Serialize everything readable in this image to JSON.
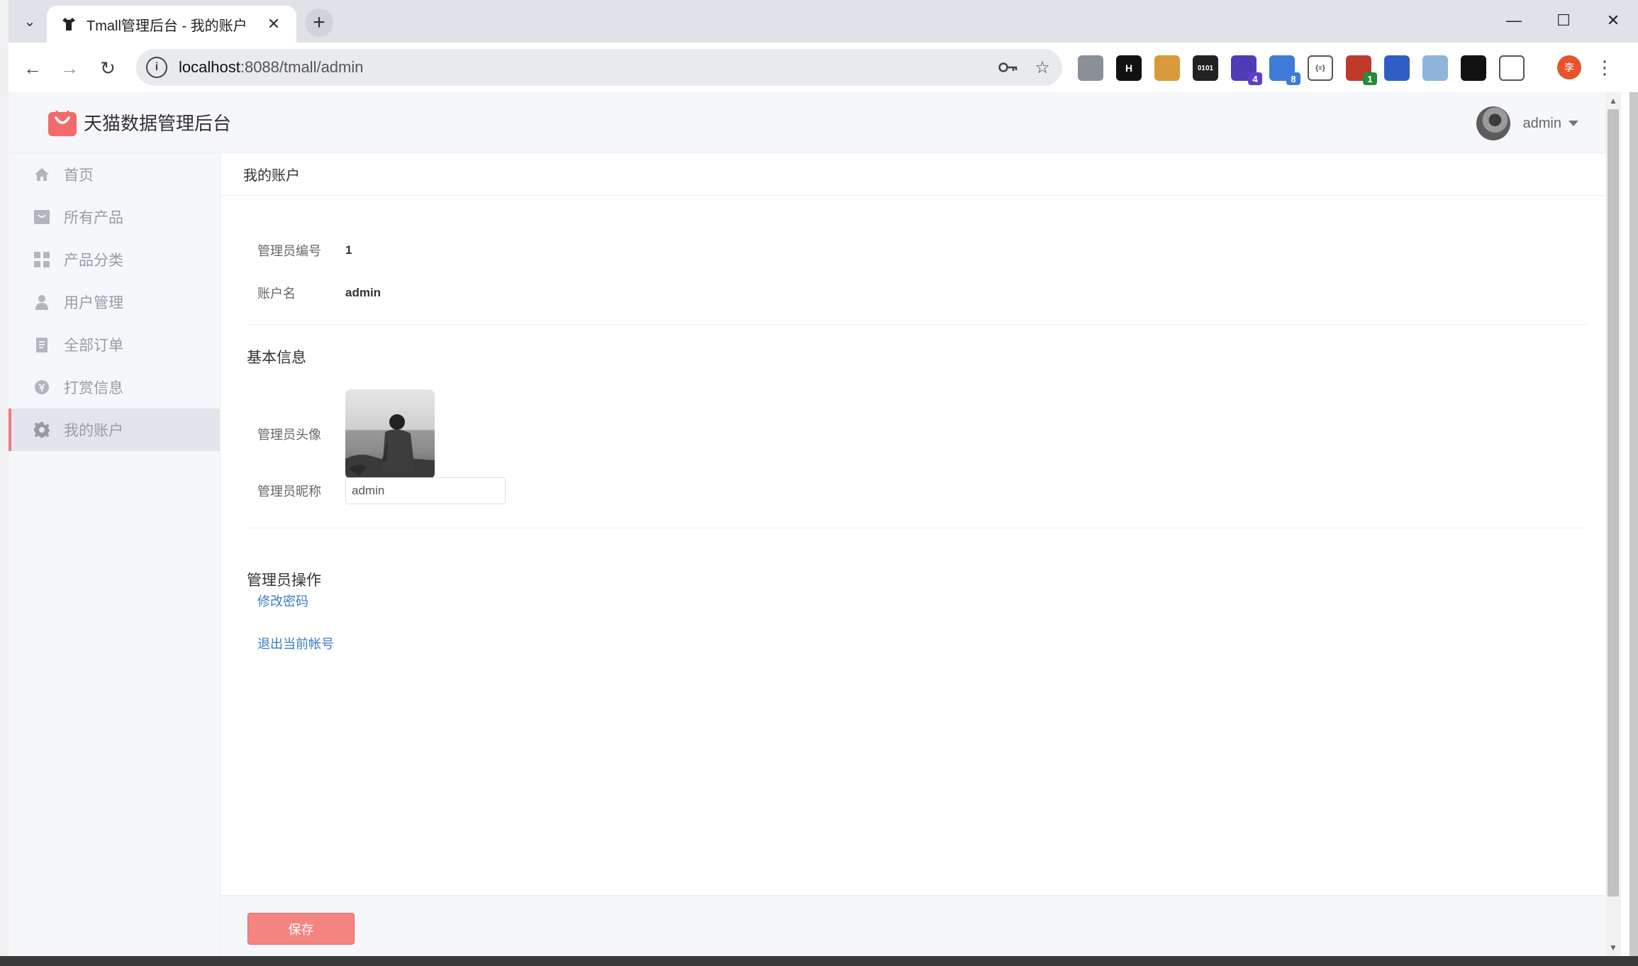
{
  "browser": {
    "tab_title": "Tmall管理后台 - 我的账户",
    "tab_close": "✕",
    "new_tab": "+",
    "url_host": "localhost",
    "url_rest": ":8088/tmall/admin",
    "profile_initial": "李",
    "extensions": [
      {
        "name": "globe-extension-icon",
        "label": "",
        "color": "#8a8f98"
      },
      {
        "name": "h-extension-icon",
        "label": "H",
        "color": "#111111"
      },
      {
        "name": "cookie-extension-icon",
        "label": "",
        "color": "#d89a3a"
      },
      {
        "name": "binary-extension-icon",
        "label": "0101",
        "color": "#222222"
      },
      {
        "name": "shapes-extension-icon",
        "label": "",
        "color": "#4f3bb5",
        "badge": "4",
        "badge_color": "#5b3fc8"
      },
      {
        "name": "screenshot-extension-icon",
        "label": "",
        "color": "#3d7bd9",
        "badge": "8",
        "badge_color": "#3d7bd9"
      },
      {
        "name": "json-extension-icon",
        "label": "{≡}",
        "color": "#ffffff"
      },
      {
        "name": "counter-extension-icon",
        "label": "",
        "color": "#c0392b",
        "badge": "1",
        "badge_color": "#1f8f3a"
      },
      {
        "name": "bookmark-extension-icon",
        "label": "",
        "color": "#2f5fc4"
      },
      {
        "name": "person-extension-icon",
        "label": "",
        "color": "#8fb5dd"
      },
      {
        "name": "glasses-extension-icon",
        "label": "",
        "color": "#111111"
      },
      {
        "name": "puzzle-extension-icon",
        "label": "",
        "color": "#ffffff"
      }
    ]
  },
  "app": {
    "brand_title": "天猫数据管理后台",
    "user_name": "admin",
    "colors": {
      "accent": "#f07a7a",
      "link": "#3a7cc6",
      "sidebar_bg": "#f6f7fb"
    }
  },
  "sidebar": {
    "items": [
      {
        "label": "首页",
        "icon": "home-icon",
        "active": false
      },
      {
        "label": "所有产品",
        "icon": "product-icon",
        "active": false
      },
      {
        "label": "产品分类",
        "icon": "category-icon",
        "active": false
      },
      {
        "label": "用户管理",
        "icon": "user-icon",
        "active": false
      },
      {
        "label": "全部订单",
        "icon": "order-icon",
        "active": false
      },
      {
        "label": "打赏信息",
        "icon": "reward-icon",
        "active": false
      },
      {
        "label": "我的账户",
        "icon": "gear-icon",
        "active": true
      }
    ]
  },
  "content": {
    "title": "我的账户",
    "admin_id_label": "管理员编号",
    "admin_id_value": "1",
    "account_label": "账户名",
    "account_value": "admin",
    "basic_section": "基本信息",
    "avatar_label": "管理员头像",
    "nickname_label": "管理员昵称",
    "nickname_value": "admin",
    "ops_section": "管理员操作",
    "change_password": "修改密码",
    "logout": "退出当前帐号",
    "save_label": "保存"
  }
}
